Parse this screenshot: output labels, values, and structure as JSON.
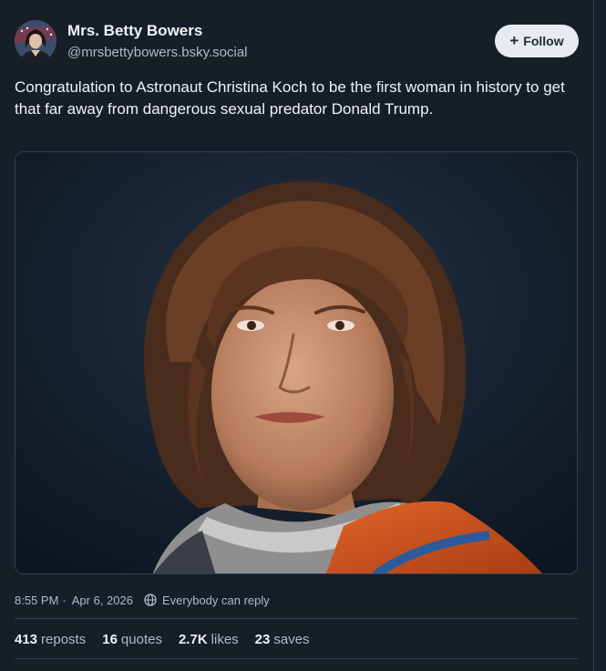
{
  "post": {
    "author": {
      "display_name": "Mrs. Betty Bowers",
      "handle": "@mrsbettybowers.bsky.social"
    },
    "follow_button": {
      "icon": "plus-icon",
      "label": "Follow"
    },
    "text": "Congratulation to Astronaut Christina Koch to be the first woman in history to get that far away from dangerous sexual predator Donald Trump.",
    "timestamp": "8:55 PM",
    "separator": "·",
    "date": "Apr 6, 2026",
    "reply_setting": {
      "icon": "globe-icon",
      "label": "Everybody can reply"
    },
    "stats": {
      "reposts_count": "413",
      "reposts_label": "reposts",
      "quotes_count": "16",
      "quotes_label": "quotes",
      "likes_count": "2.7K",
      "likes_label": "likes",
      "saves_count": "23",
      "saves_label": "saves"
    }
  },
  "theme": {
    "background": "#161e27",
    "text": "#f1f3f5",
    "muted_text": "#aebbc9",
    "border": "#2e4052",
    "follow_button_bg": "#e6ebf0",
    "follow_button_text": "#1e2936",
    "spacesuit_orange": "#d9541c"
  }
}
